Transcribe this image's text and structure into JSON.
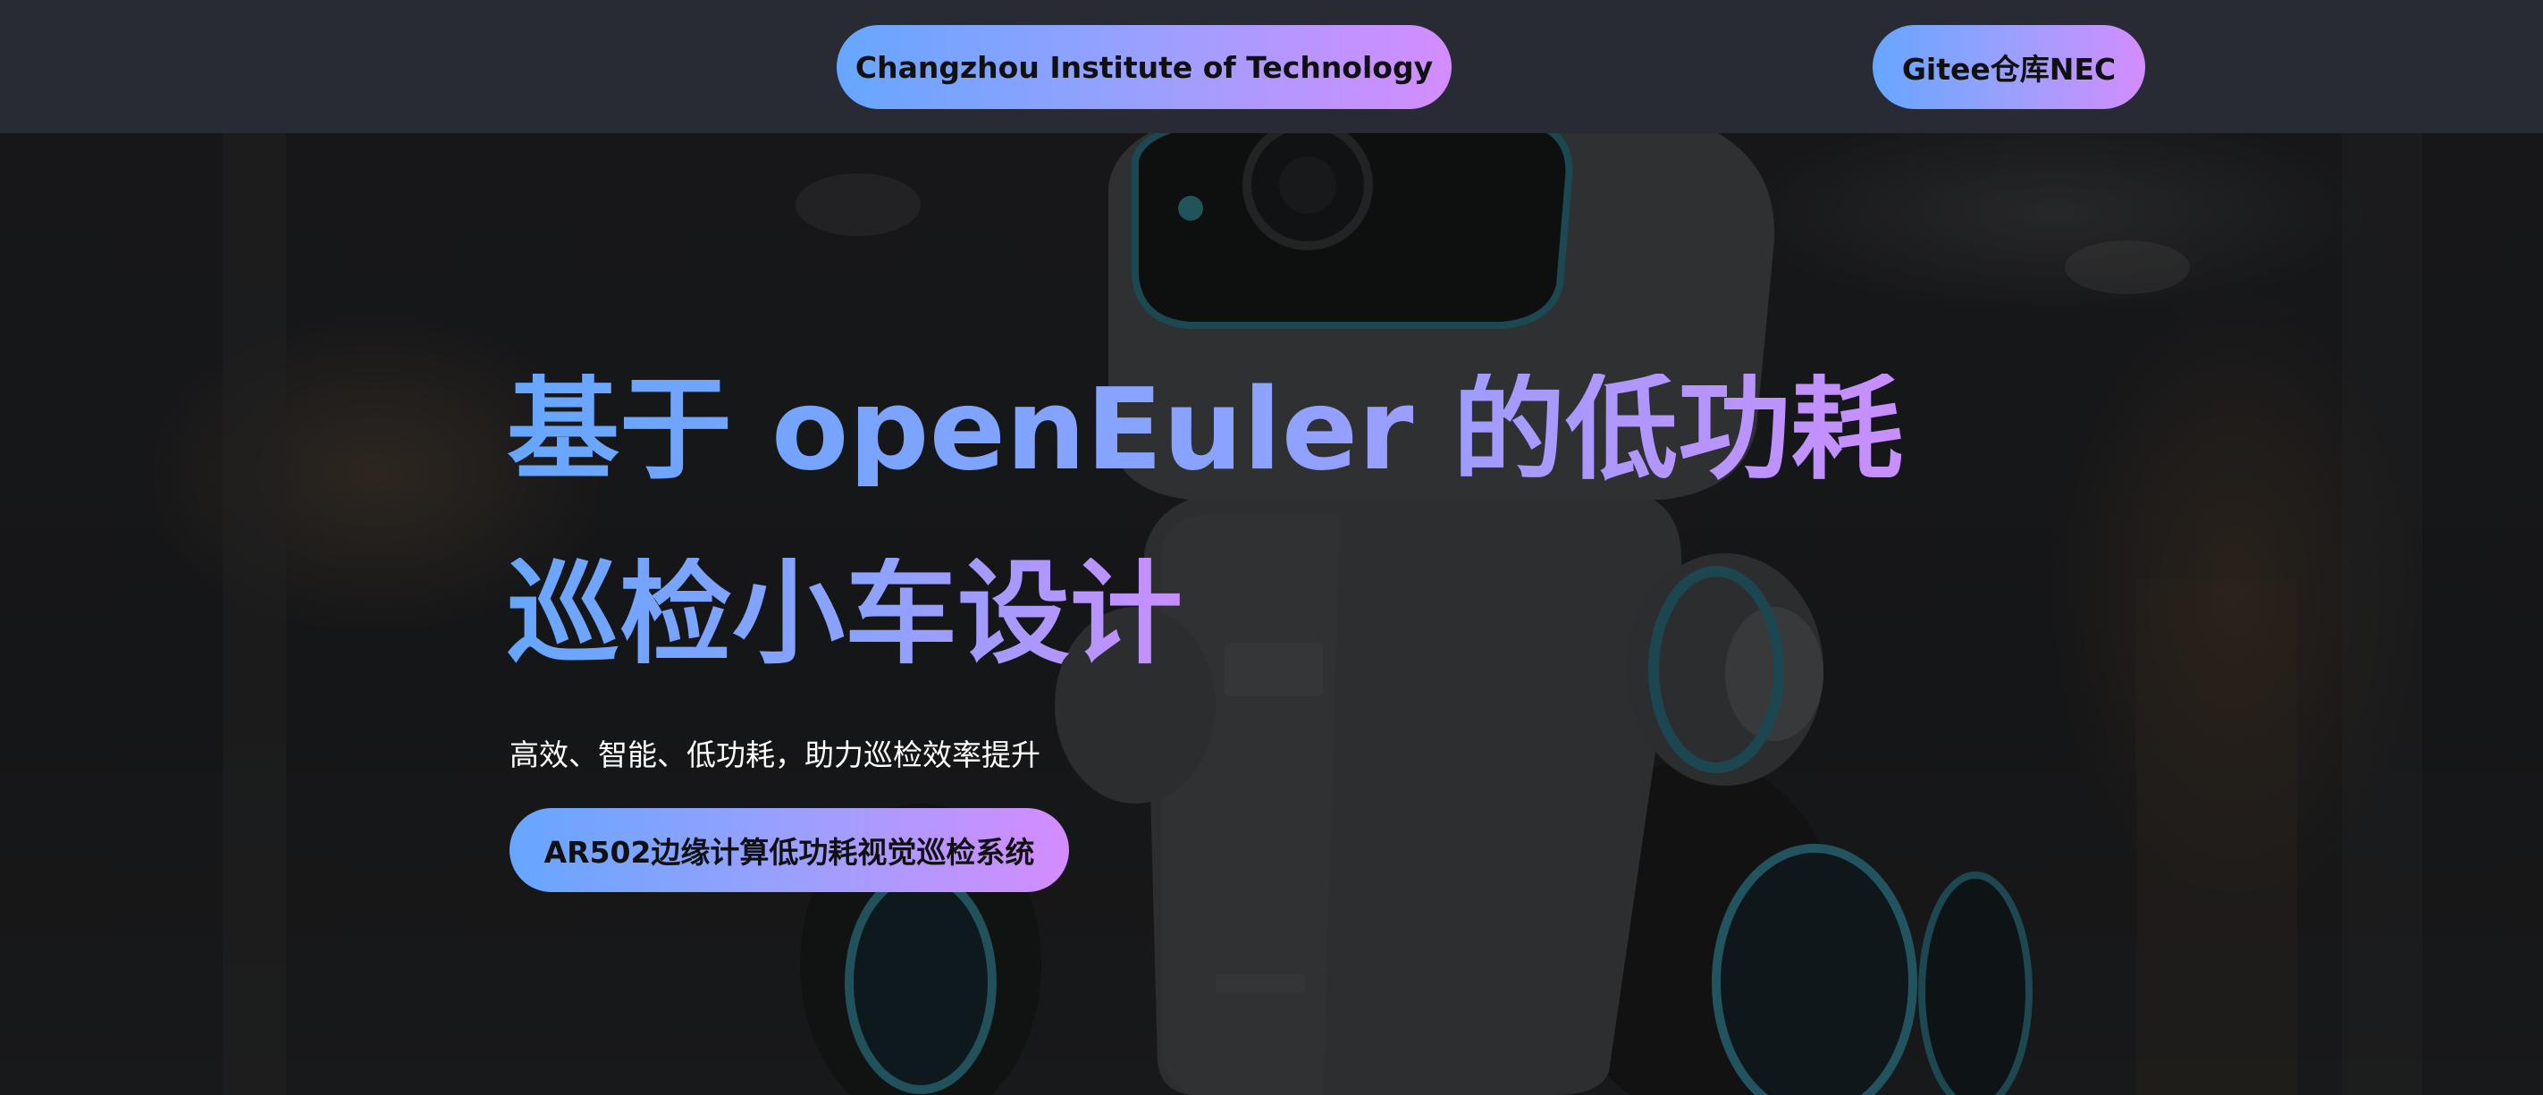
{
  "nav": {
    "school_label": "Changzhou Institute of Technology",
    "repo_label": "Gitee仓库NEC"
  },
  "hero": {
    "title_line1": "基于 openEuler 的低功耗",
    "title_line2": "巡检小车设计",
    "subtitle": "高效、智能、低功耗，助力巡检效率提升",
    "cta_label": "AR502边缘计算低功耗视觉巡检系统"
  },
  "colors": {
    "topbar_bg": "#282b34",
    "gradient_start": "#66a6ff",
    "gradient_end": "#d48cff",
    "button_text": "#111111",
    "subtitle_text": "#ffffff"
  }
}
